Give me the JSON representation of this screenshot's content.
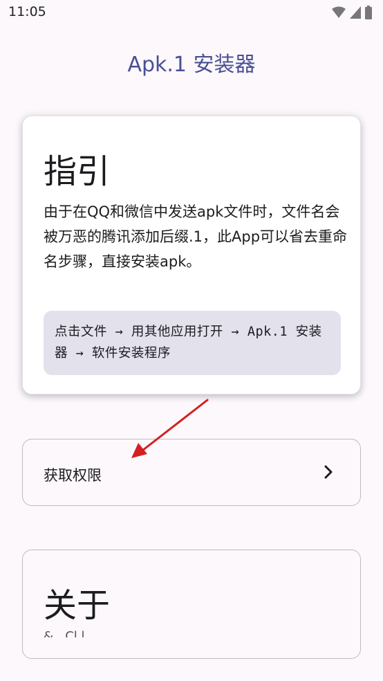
{
  "status_bar": {
    "time": "11:05"
  },
  "app": {
    "title": "Apk.1 安装器"
  },
  "guide": {
    "title": "指引",
    "description": "由于在QQ和微信中发送apk文件时，文件名会被万恶的腾讯添加后缀.1，此App可以省去重命名步骤，直接安装apk。",
    "steps": "点击文件 → 用其他应用打开 → Apk.1 安装器 → 软件安装程序"
  },
  "permission": {
    "label": "获取权限"
  },
  "about": {
    "title": "关于",
    "partial_text": "& ..Cl.l.."
  },
  "colors": {
    "accent": "#4a4f94",
    "background": "#fcf8fc",
    "steps_bg": "#e3e1ec",
    "annotation": "#d42020"
  },
  "icons": [
    "wifi-icon",
    "signal-icon",
    "battery-icon",
    "chevron-right-icon"
  ]
}
